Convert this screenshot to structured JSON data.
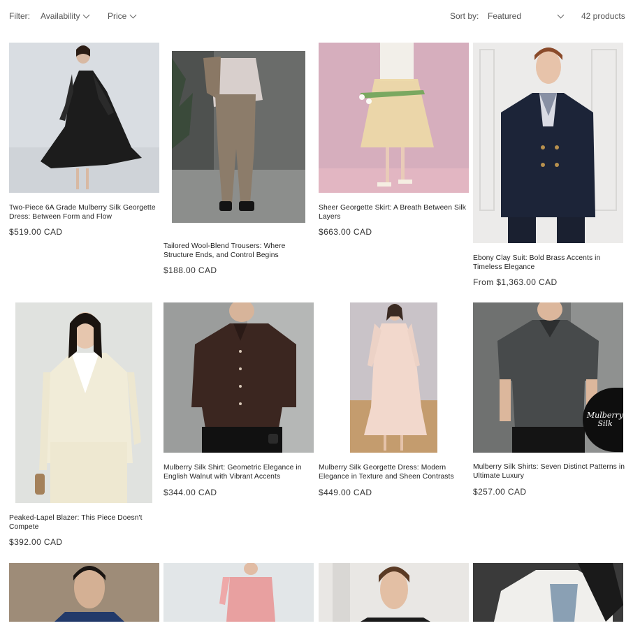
{
  "toolbar": {
    "filter_label": "Filter:",
    "availability": "Availability",
    "price": "Price",
    "sort_label": "Sort by:",
    "sort_value": "Featured",
    "count": "42 products"
  },
  "products": [
    {
      "title": "Two-Piece 6A Grade Mulberry Silk Georgette Dress: Between Form and Flow",
      "price": "$519.00 CAD"
    },
    {
      "title": "Tailored Wool-Blend Trousers: Where Structure Ends, and Control Begins",
      "price": "$188.00 CAD"
    },
    {
      "title": "Sheer Georgette Skirt: A Breath Between Silk Layers",
      "price": "$663.00 CAD"
    },
    {
      "title": "Ebony Clay Suit: Bold Brass Accents in Timeless Elegance",
      "price": "From $1,363.00 CAD"
    },
    {
      "title": "Peaked-Lapel Blazer: This Piece Doesn't Compete",
      "price": "$392.00 CAD"
    },
    {
      "title": "Mulberry Silk Shirt: Geometric Elegance in English Walnut with Vibrant Accents",
      "price": "$344.00 CAD"
    },
    {
      "title": "Mulberry Silk Georgette Dress: Modern Elegance in Texture and Sheen Contrasts",
      "price": "$449.00 CAD"
    },
    {
      "title": "Mulberry Silk Shirts: Seven Distinct Patterns in Ultimate Luxury",
      "price": "$257.00 CAD"
    }
  ],
  "badge_text": "Mulberry Silk",
  "colors": {
    "text": "#121212",
    "muted": "#555555"
  }
}
